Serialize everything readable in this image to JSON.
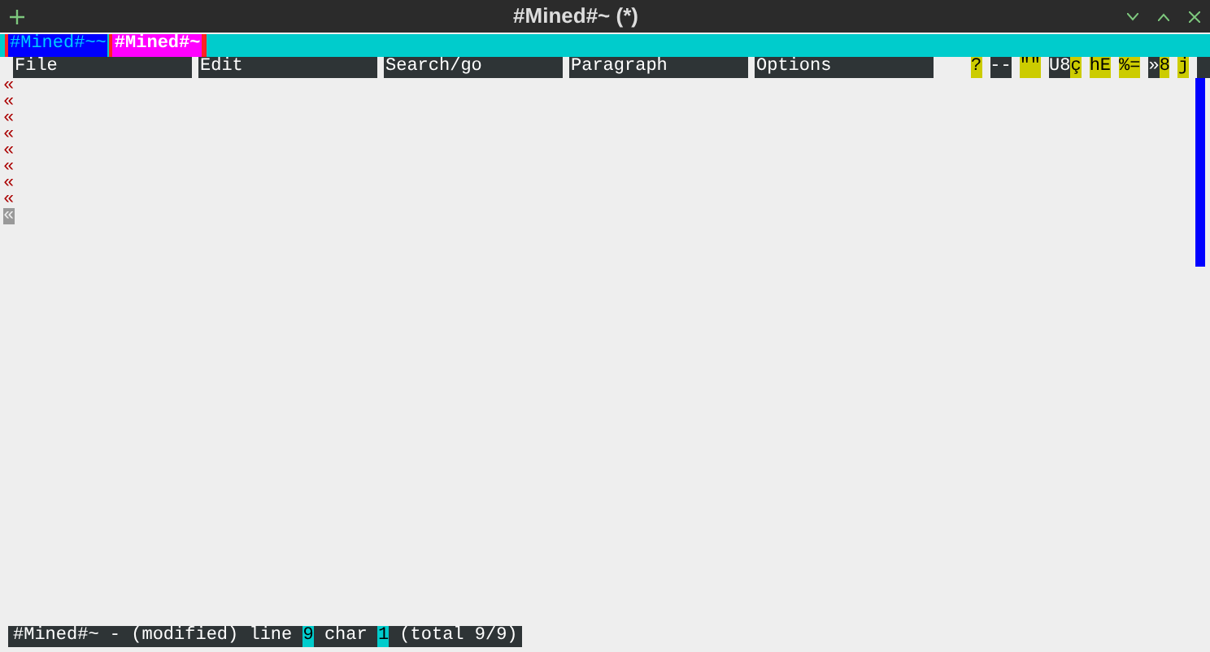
{
  "window": {
    "title": "#Mined#~ (*)"
  },
  "tabs": [
    {
      "label": "#Mined#~~",
      "selected": false
    },
    {
      "label": "#Mined#~",
      "selected": true
    }
  ],
  "menu": [
    "File",
    "Edit",
    "Search/go",
    "Paragraph",
    "Options"
  ],
  "flags": [
    {
      "text": "?",
      "kind": "on"
    },
    {
      "text": "--",
      "kind": "off"
    },
    {
      "text": "\"\"",
      "kind": "on"
    },
    {
      "text": "U8",
      "kind": "off"
    },
    {
      "text": "ç",
      "kind": "on"
    },
    {
      "text": "hE",
      "kind": "on"
    },
    {
      "text": "%=",
      "kind": "on"
    },
    {
      "text": "»",
      "kind": "off"
    },
    {
      "text": "8",
      "kind": "on"
    },
    {
      "text": "j",
      "kind": "on"
    }
  ],
  "lines": [
    {
      "mark": "«",
      "cursor": false
    },
    {
      "mark": "«",
      "cursor": false
    },
    {
      "mark": "«",
      "cursor": false
    },
    {
      "mark": "«",
      "cursor": false
    },
    {
      "mark": "«",
      "cursor": false
    },
    {
      "mark": "«",
      "cursor": false
    },
    {
      "mark": "«",
      "cursor": false
    },
    {
      "mark": "«",
      "cursor": false
    },
    {
      "mark": "«",
      "cursor": true
    }
  ],
  "status_bar": [
    {
      "text": "#Mined#~ - (modified) line ",
      "kind": "plain"
    },
    {
      "text": "9",
      "kind": "value"
    },
    {
      "text": " char ",
      "kind": "plain"
    },
    {
      "text": "1",
      "kind": "value"
    },
    {
      "text": " (total 9/9)",
      "kind": "plain"
    }
  ]
}
